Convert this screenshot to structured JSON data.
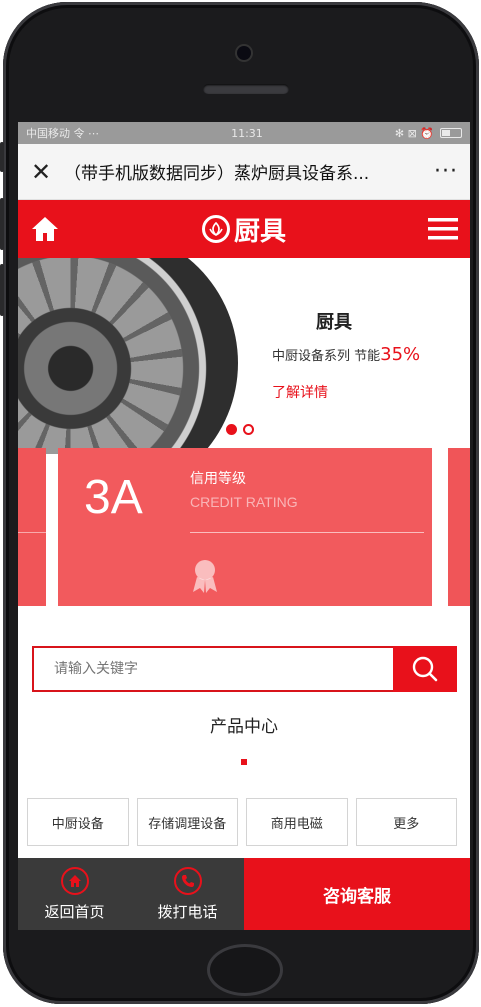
{
  "status_bar": {
    "carrier": "中国移动 令 ⋯",
    "time": "11:31",
    "icons": "✻ ⊠ ⏰"
  },
  "wechat_bar": {
    "close_glyph": "✕",
    "title": "（带手机版数据同步）蒸炉厨具设备系...",
    "more_glyph": "···"
  },
  "site_nav": {
    "logo_text": "厨具"
  },
  "banner": {
    "title": "厨具",
    "subtitle": "中厨设备系列  节能",
    "highlight": "35%",
    "link": "了解详情",
    "slide_count": 2,
    "active_slide": 1
  },
  "credit_card": {
    "big": "3A",
    "title": "信用等级",
    "title_en": "CREDIT RATING"
  },
  "search": {
    "placeholder": "请输入关键字"
  },
  "products": {
    "title": "产品中心",
    "categories": [
      "中厨设备",
      "存储调理设备",
      "商用电磁",
      "更多"
    ]
  },
  "bottom_nav": {
    "home_label": "返回首页",
    "call_label": "拨打电话",
    "consult_label": "咨询客服"
  },
  "colors": {
    "brand_red": "#e8111b",
    "card_red": "#f25a5d",
    "bottom_dark": "#3a3a3a"
  }
}
